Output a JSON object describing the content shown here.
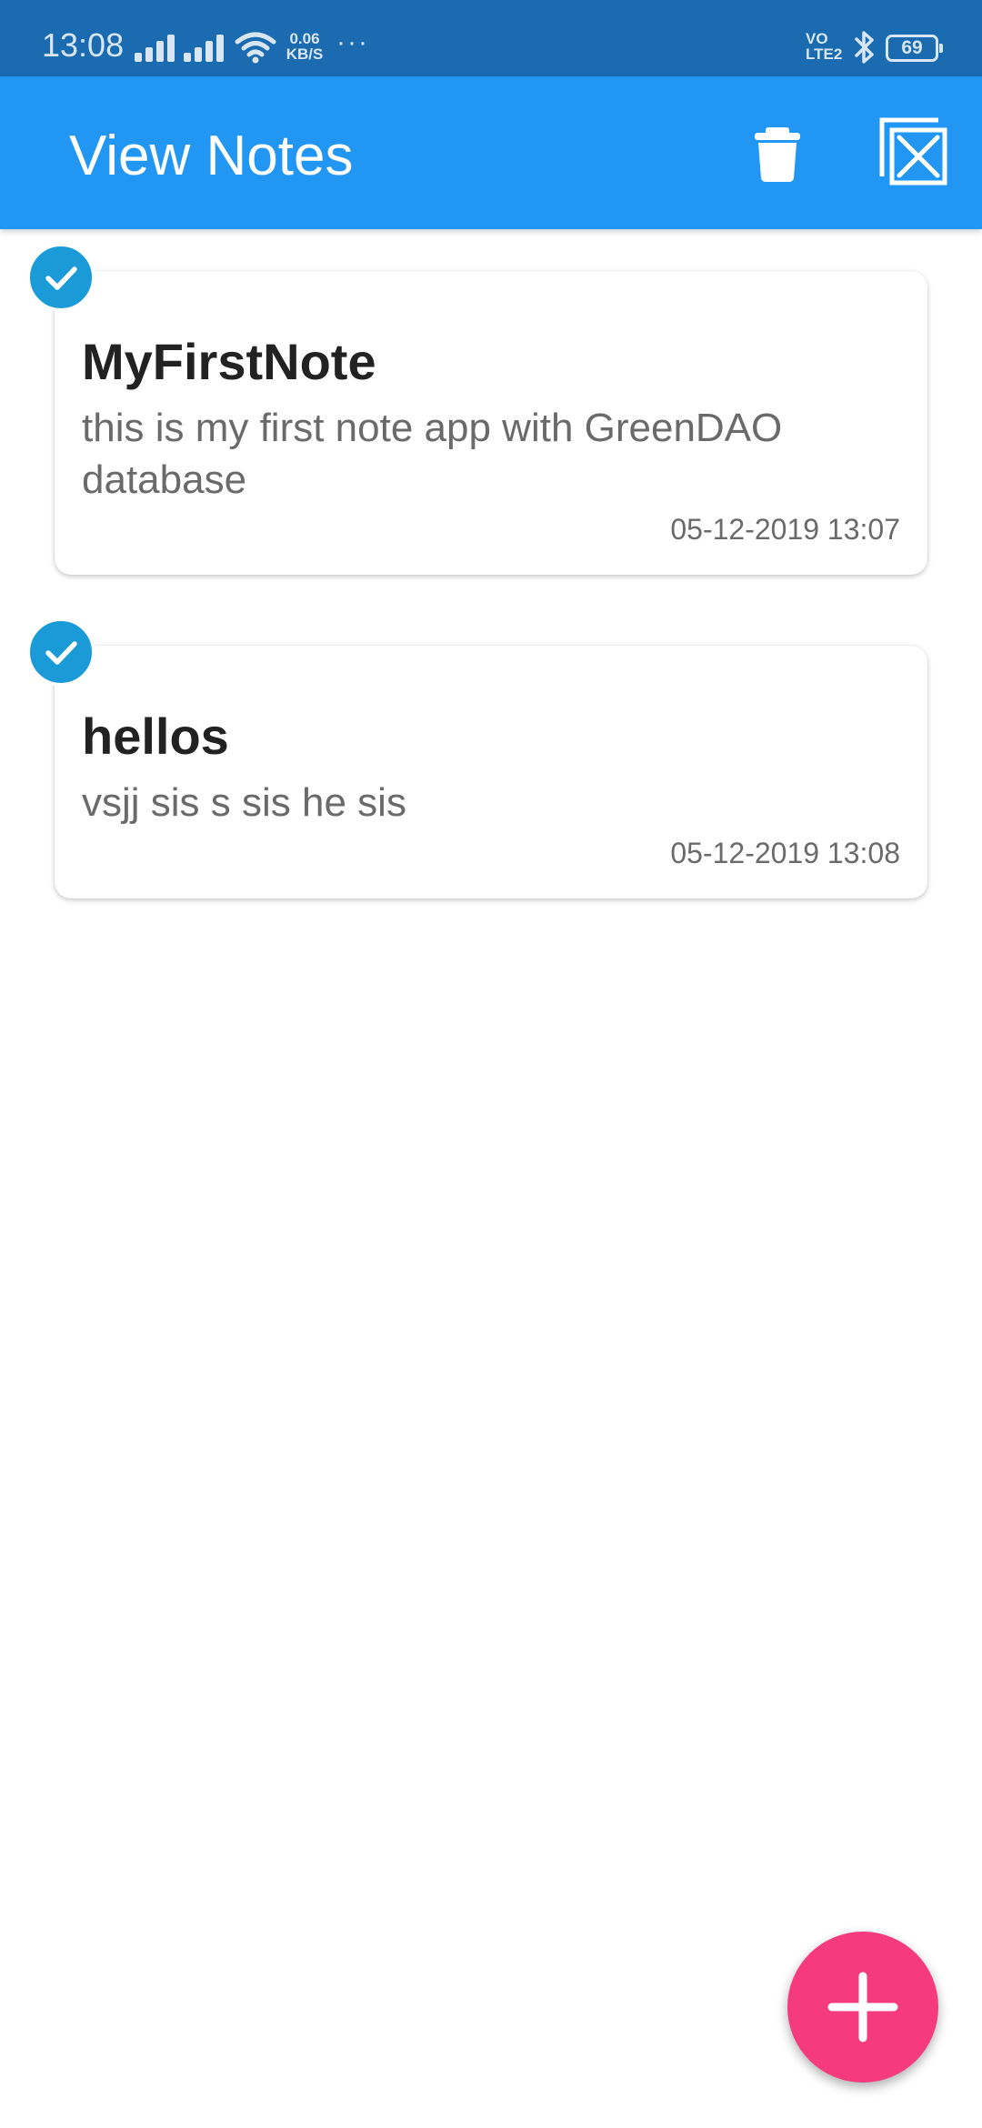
{
  "status_bar": {
    "time": "13:08",
    "net_speed_value": "0.06",
    "net_speed_unit": "KB/S",
    "overflow_dots": "···",
    "volte_top": "VO",
    "volte_bottom": "LTE2",
    "battery_level": "69",
    "icons": [
      "signal-icon",
      "signal-icon",
      "wifi-icon",
      "bluetooth-icon",
      "battery-icon"
    ]
  },
  "app_bar": {
    "title": "View Notes",
    "background_color": "#2196f3",
    "actions": [
      "delete-icon",
      "deselect-all-icon"
    ]
  },
  "notes": [
    {
      "title": "MyFirstNote",
      "body": "this is my first note app with GreenDAO database",
      "date": "05-12-2019 13:07",
      "selected": true
    },
    {
      "title": "hellos",
      "body": "vsjj sis s sis he sis",
      "date": "05-12-2019 13:08",
      "selected": true
    }
  ],
  "fab": {
    "icon": "add-icon",
    "color": "#f53a7e"
  },
  "colors": {
    "status_bar": "#1a6bb0",
    "selection_badge": "#1a9bd7"
  }
}
